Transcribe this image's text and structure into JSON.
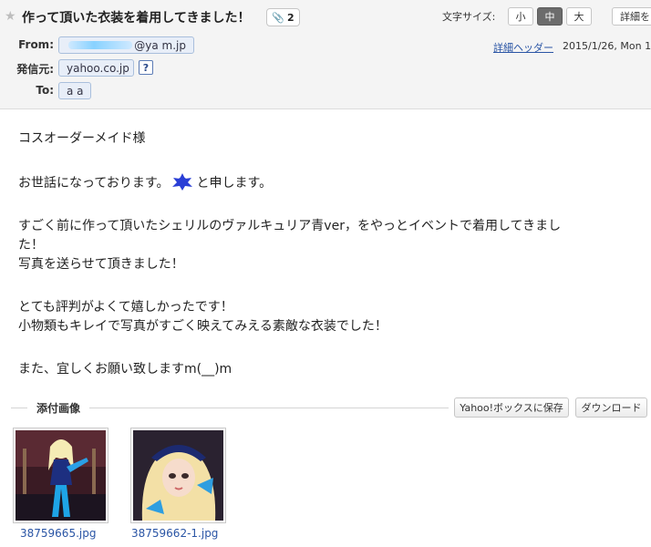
{
  "header": {
    "star_icon": "star-icon",
    "subject": "作って頂いた衣装を着用してきました！",
    "attachment_count": "2",
    "font_size_label": "文字サイズ:",
    "font_sizes": [
      "小",
      "中",
      "大"
    ],
    "font_size_selected": "中",
    "detail_button": "詳細を",
    "from_label": "From:",
    "from_value": "@ya    m.jp",
    "sender_label": "発信元:",
    "sender_value": "yahoo.co.jp",
    "help_label": "?",
    "to_label": "To:",
    "to_value": "a a",
    "detail_header_link": "詳細ヘッダー",
    "date": "2015/1/26, Mon 1"
  },
  "body": {
    "lines": [
      "コスオーダーメイド様",
      "お世話になっております。",
      "と申します。",
      "すごく前に作って頂いたシェリルのヴァルキュリア青ver，をやっとイベントで着用してきまし",
      "た！",
      "写真を送らせて頂きました！",
      "とても評判がよくて嬉しかったです！",
      "小物類もキレイで写真がすごく映えてみえる素敵な衣装でした！",
      "また、宜しくお願い致しますm(__)m"
    ]
  },
  "attachments": {
    "title": "添付画像",
    "save_button": "Yahoo!ボックスに保存",
    "download_button": "ダウンロード",
    "files": [
      {
        "name": "38759665.jpg"
      },
      {
        "name": "38759662-1.jpg"
      }
    ]
  },
  "colors": {
    "link": "#2a55a5",
    "header_bg": "#f4f4f4",
    "chip_bg": "#e8eef8",
    "active_button": "#6c6c6c"
  }
}
